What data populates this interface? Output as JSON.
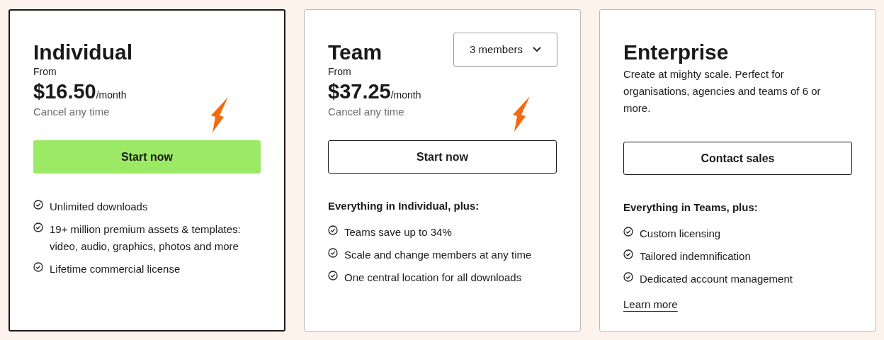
{
  "plans": [
    {
      "name": "Individual",
      "selected": true,
      "from": "From",
      "price": "$16.50",
      "period": "/month",
      "note": "Cancel any time",
      "button": {
        "label": "Start now",
        "kind": "primary"
      },
      "features": [
        "Unlimited downloads",
        "19+ million premium assets & templates: video, audio, graphics, photos and more",
        "Lifetime commercial license"
      ]
    },
    {
      "name": "Team",
      "selected": false,
      "dropdown": "3 members",
      "from": "From",
      "price": "$37.25",
      "period": "/month",
      "note": "Cancel any time",
      "button": {
        "label": "Start now",
        "kind": "outline"
      },
      "features_heading": "Everything in Individual, plus:",
      "features": [
        "Teams save up to 34%",
        "Scale and change members at any time",
        "One central location for all downloads"
      ]
    },
    {
      "name": "Enterprise",
      "selected": false,
      "description": "Create at mighty scale. Perfect for organisations, agencies and teams of 6 or more.",
      "button": {
        "label": "Contact sales",
        "kind": "outline"
      },
      "features_heading": "Everything in Teams, plus:",
      "features": [
        "Custom licensing",
        "Tailored indemnification",
        "Dedicated account management"
      ],
      "link": "Learn more"
    }
  ]
}
